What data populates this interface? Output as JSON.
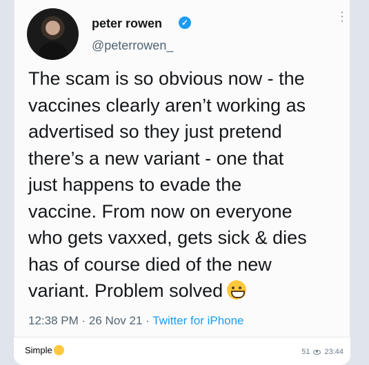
{
  "tweet": {
    "display_name": "peter rowen",
    "handle": "@peterrowen_",
    "verified_icon": "verified-badge-icon",
    "text": "The scam is so obvious now - the\nvaccines clearly aren’t working as\nadvertised so they just pretend\nthere’s a new variant - one that\njust happens to evade the\nvaccine. From now on everyone\nwho gets vaxxed, gets sick & dies\nhas of course died of the new\nvariant. Problem solved",
    "emoji": "grinning-face-emoji",
    "time": "12:38 PM",
    "date": "26 Nov 21",
    "source": "Twitter for iPhone",
    "separator": "·"
  },
  "message": {
    "caption": "Simple",
    "caption_emoji": "relieved-face-emoji",
    "views": "51",
    "timestamp": "23:44"
  },
  "colors": {
    "accent": "#1d9bf0",
    "text": "#14171a",
    "secondary": "#536471"
  }
}
